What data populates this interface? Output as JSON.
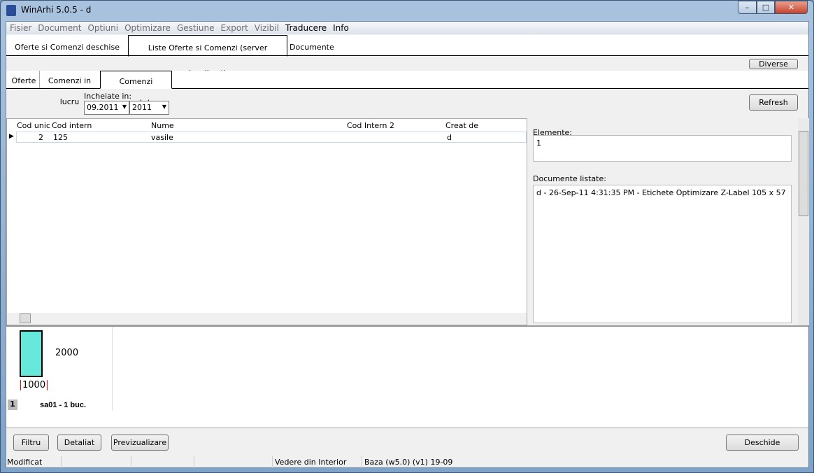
{
  "window": {
    "title": "WinArhi 5.0.5 - d",
    "min": "–",
    "max": "□",
    "close": "✕"
  },
  "menu": [
    "Fisier",
    "Document",
    "Optiuni",
    "Optimizare",
    "Gestiune",
    "Export",
    "Vizibil",
    "Traducere",
    "Info"
  ],
  "tabs": [
    "Oferte si Comenzi deschise",
    "Liste Oferte si Comenzi   (server localhost)",
    "Documente"
  ],
  "diverse": "Diverse",
  "subtabs": [
    "Oferte",
    "Comenzi in lucru",
    "Comenzi executate"
  ],
  "filter": {
    "label": "Incheiate in:",
    "month": "09.2011",
    "year": "2011"
  },
  "refresh": "Refresh",
  "grid": {
    "columns": [
      "Cod unic",
      "Cod intern",
      "Nume",
      "Cod Intern 2",
      "Creat de"
    ],
    "rows": [
      [
        "2",
        "125",
        "vasile",
        "",
        "d"
      ]
    ]
  },
  "elemente": {
    "label": "Elemente:",
    "value": "1"
  },
  "documente": {
    "label": "Documente listate:",
    "items": [
      "d - 26-Sep-11 4:31:35 PM - Etichete Optimizare Z-Label 105 x 57"
    ]
  },
  "preview": {
    "height": "2000",
    "width": "1000",
    "index": "1",
    "caption": "sa01 - 1 buc."
  },
  "buttons": {
    "filtru": "Filtru",
    "detaliat": "Detaliat",
    "previzualizare": "Previzualizare",
    "deschide": "Deschide"
  },
  "status": [
    "Modificat",
    "",
    "",
    "",
    "Vedere din Interior",
    "Baza (w5.0) (v1) 19-09"
  ]
}
